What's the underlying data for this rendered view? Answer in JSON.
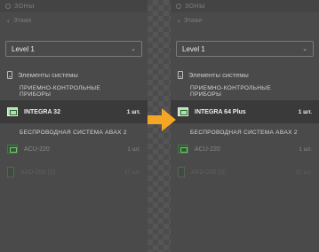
{
  "panels": [
    {
      "top_title": "ЗОНЫ",
      "sub_title": "Этажи",
      "level": "Level 1",
      "section": "Элементы системы",
      "group1": "ПРИЕМНО-КОНТРОЛЬНЫЕ ПРИБОРЫ",
      "selected": {
        "name": "INTEGRA 32",
        "qty": "1 шт."
      },
      "group2": "БЕСПРОВОДНАЯ СИСТЕМА ABAX 2",
      "items": [
        {
          "name": "ACU-220",
          "qty": "1 шт."
        },
        {
          "name": "AXD-200 (S)",
          "qty": "37 шт."
        }
      ]
    },
    {
      "top_title": "ЗОНЫ",
      "sub_title": "Этажи",
      "level": "Level 1",
      "section": "Элементы системы",
      "group1": "ПРИЕМНО-КОНТРОЛЬНЫЕ ПРИБОРЫ",
      "selected": {
        "name": "INTEGRA 64 Plus",
        "qty": "1 шт."
      },
      "group2": "БЕСПРОВОДНАЯ СИСТЕМА ABAX 2",
      "items": [
        {
          "name": "ACU-220",
          "qty": "1 шт."
        },
        {
          "name": "AXD-200 (S)",
          "qty": "37 шт."
        }
      ]
    }
  ],
  "colors": {
    "arrow": "#f5a623",
    "panel": "#4a4a4a",
    "chip": "#b5dcb5"
  }
}
